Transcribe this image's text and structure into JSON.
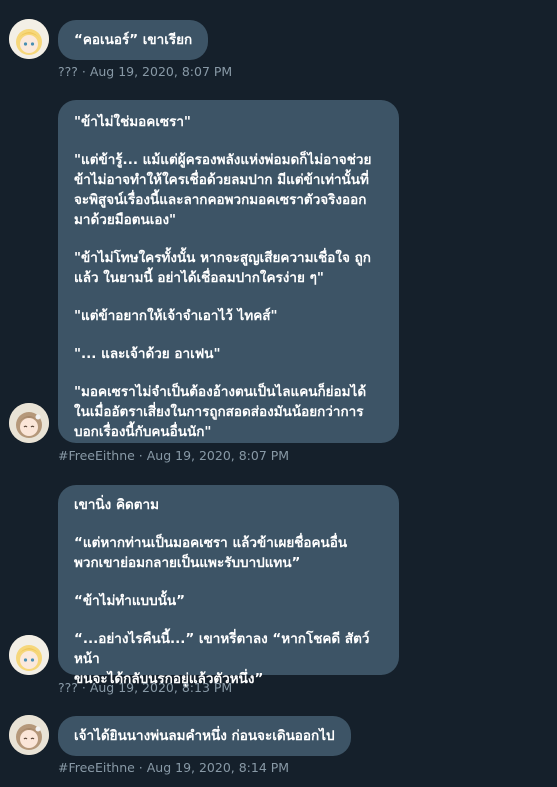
{
  "messages": [
    {
      "sender": "???",
      "time": "Aug 19, 2020, 8:07 PM",
      "avatar_icon": "blonde-girl-avatar-icon",
      "paragraphs": [
        "“คอเนอร์” เขาเรียก"
      ]
    },
    {
      "sender": "#FreeEithne",
      "time": "Aug 19, 2020, 8:07 PM",
      "avatar_icon": "brown-hair-girl-avatar-icon",
      "paragraphs": [
        "\"ข้าไม่ใช่มอคเซรา\"",
        "\"แต่ข้ารู้... แม้แต่ผู้ครองพลังแห่งพ่อมดก็ไม่อาจช่วย\nข้าไม่อาจทำให้ใครเชื่อด้วยลมปาก มีแต่ข้าเท่านั้นที่\nจะพิสูจน์เรื่องนี้และลากคอพวกมอคเซราตัวจริงออก\nมาด้วยมือตนเอง\"",
        "\"ข้าไม่โทษใครทั้งนั้น หากจะสูญเสียความเชื่อใจ ถูก\nแล้ว ในยามนี้ อย่าได้เชื่อลมปากใครง่าย ๆ\"",
        "\"แต่ข้าอยากให้เจ้าจำเอาไว้ ไทคส์\"",
        "\"... และเจ้าด้วย อาเฟน\"",
        "\"มอคเซราไม่จำเป็นต้องอ้างตนเป็นไลแคนก็ย่อมได้\nในเมื่ออัตราเสี่ยงในการถูกสอดส่องมันน้อยกว่าการ\nบอกเรื่องนี้กับคนอื่นนัก\""
      ]
    },
    {
      "sender": "???",
      "time": "Aug 19, 2020, 8:13 PM",
      "avatar_icon": "blonde-girl-avatar-icon",
      "paragraphs": [
        "เขานิ่ง คิดตาม",
        "“แต่หากท่านเป็นมอคเซรา แล้วข้าเผยชื่อคนอื่น\nพวกเขาย่อมกลายเป็นแพะรับบาปแทน”",
        "“ข้าไม่ทำแบบนั้น”",
        "“...อย่างไรคืนนี้...” เขาหรี่ตาลง “หากโชคดี สัตว์หน้า\nขนจะได้กลับนรกอยู่แล้วตัวหนึ่ง”"
      ]
    },
    {
      "sender": "#FreeEithne",
      "time": "Aug 19, 2020, 8:14 PM",
      "avatar_icon": "brown-hair-girl-avatar-icon",
      "paragraphs": [
        "เจ้าได้ยินนางพ่นลมคำหนึ่ง ก่อนจะเดินออกไป"
      ]
    }
  ],
  "meta_separator": " · ",
  "colors": {
    "background": "#15202b",
    "bubble": "#3d5466",
    "meta_text": "#8899a6"
  }
}
